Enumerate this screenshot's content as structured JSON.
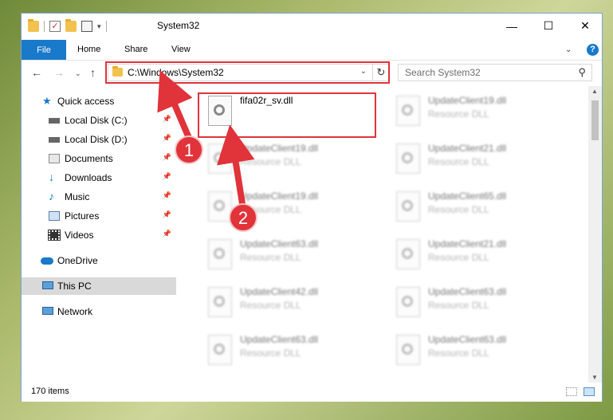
{
  "window": {
    "title": "System32",
    "controls": {
      "minimize": "—",
      "maximize": "☐",
      "close": "✕"
    }
  },
  "ribbon": {
    "tabs": [
      "File",
      "Home",
      "Share",
      "View"
    ],
    "help": "?"
  },
  "navbar": {
    "address": "C:\\Windows\\System32",
    "search_placeholder": "Search System32"
  },
  "sidebar": {
    "items": [
      {
        "label": "Quick access",
        "icon": "star-icon"
      },
      {
        "label": "Local Disk (C:)",
        "icon": "drive-icon",
        "pinned": true
      },
      {
        "label": "Local Disk (D:)",
        "icon": "drive-icon",
        "pinned": true
      },
      {
        "label": "Documents",
        "icon": "documents-icon",
        "pinned": true
      },
      {
        "label": "Downloads",
        "icon": "download-arrow-icon",
        "pinned": true
      },
      {
        "label": "Music",
        "icon": "music-note-icon",
        "pinned": true
      },
      {
        "label": "Pictures",
        "icon": "pictures-icon",
        "pinned": true
      },
      {
        "label": "Videos",
        "icon": "film-icon",
        "pinned": true
      },
      {
        "label": "OneDrive",
        "icon": "cloud-icon"
      },
      {
        "label": "This PC",
        "icon": "computer-icon",
        "selected": true
      },
      {
        "label": "Network",
        "icon": "network-icon"
      }
    ]
  },
  "files": [
    {
      "name": "fifa02r_sv.dll",
      "type": ""
    },
    {
      "name": "UpdateClient19.dll",
      "type": "Resource DLL"
    },
    {
      "name": "UpdateClient19.dll",
      "type": "Resource DLL"
    },
    {
      "name": "UpdateClient21.dll",
      "type": "Resource DLL"
    },
    {
      "name": "UpdateClient19.dll",
      "type": "Resource DLL"
    },
    {
      "name": "UpdateClient65.dll",
      "type": "Resource DLL"
    },
    {
      "name": "UpdateClient63.dll",
      "type": "Resource DLL"
    },
    {
      "name": "UpdateClient21.dll",
      "type": "Resource DLL"
    },
    {
      "name": "UpdateClient42.dll",
      "type": "Resource DLL"
    },
    {
      "name": "UpdateClient63.dll",
      "type": "Resource DLL"
    },
    {
      "name": "UpdateClient63.dll",
      "type": "Resource DLL"
    },
    {
      "name": "UpdateClient63.dll",
      "type": "Resource DLL"
    }
  ],
  "status": {
    "item_count": "170 items"
  },
  "annotations": {
    "step1": "1",
    "step2": "2"
  },
  "colors": {
    "accent": "#1979ca",
    "highlight": "#e0333a"
  }
}
